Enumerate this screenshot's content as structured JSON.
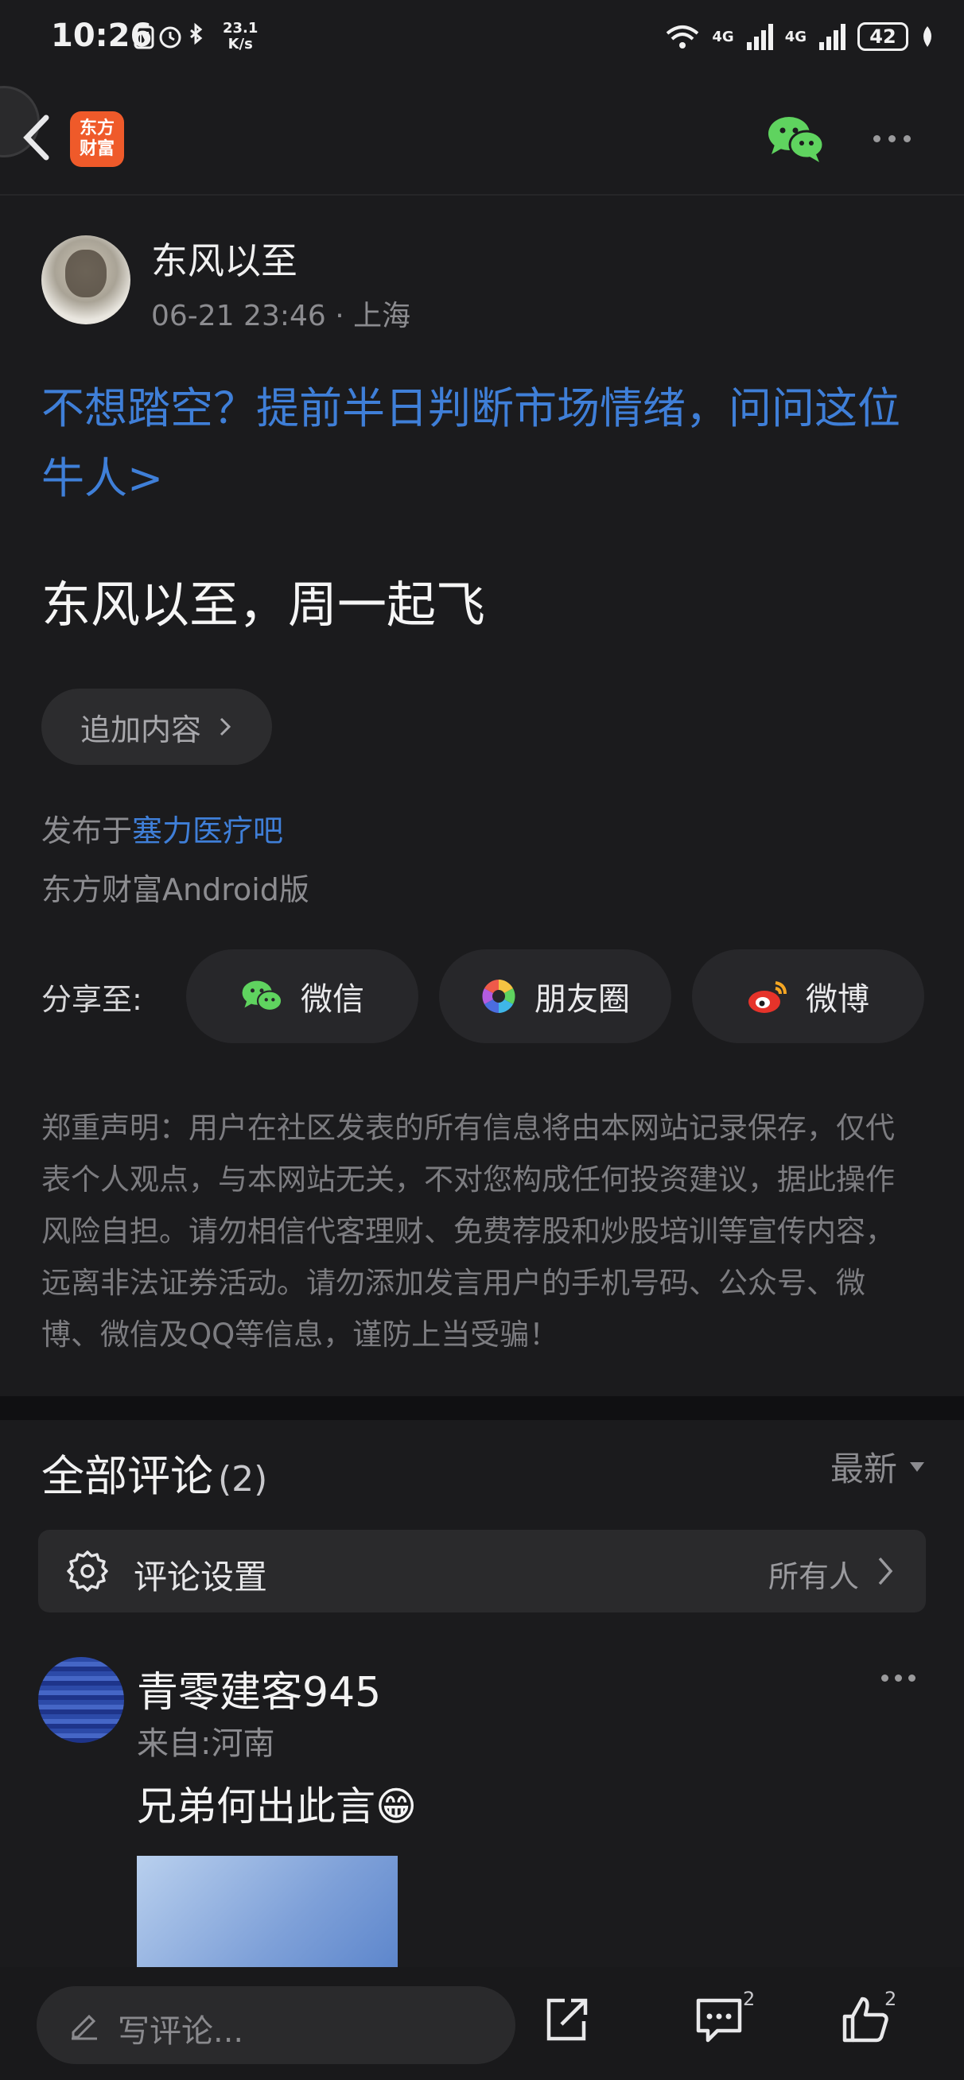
{
  "status_bar": {
    "time": "10:26",
    "speed_value": "23.1",
    "speed_unit": "K/s",
    "network_1": "4G",
    "network_2": "4G",
    "battery": "42"
  },
  "header": {
    "logo_line1": "东方",
    "logo_line2": "财富"
  },
  "post": {
    "author_name": "东风以至",
    "meta": "06-21 23:46 · 上海",
    "promo_link": "不想踏空？提前半日判断市场情绪，问问这位牛人>",
    "title": "东风以至，周一起飞",
    "add_content_label": "追加内容",
    "posted_in_prefix": "发布于",
    "forum_name": "塞力医疗吧",
    "client": "东方财富Android版"
  },
  "share": {
    "label": "分享至:",
    "wechat": "微信",
    "moments": "朋友圈",
    "weibo": "微博"
  },
  "disclaimer": "郑重声明：用户在社区发表的所有信息将由本网站记录保存，仅代表个人观点，与本网站无关，不对您构成任何投资建议，据此操作风险自担。请勿相信代客理财、免费荐股和炒股培训等宣传内容，远离非法证券活动。请勿添加发言用户的手机号码、公众号、微博、微信及QQ等信息，谨防上当受骗！",
  "comments": {
    "title": "全部评论",
    "count": "(2)",
    "sort": "最新",
    "settings_label": "评论设置",
    "settings_value": "所有人",
    "items": [
      {
        "name": "青零建客945",
        "location": "来自:河南",
        "text": "兄弟何出此言😁"
      }
    ]
  },
  "bottom_bar": {
    "placeholder": "写评论...",
    "comment_count": "2",
    "like_count": "2"
  },
  "colors": {
    "background": "#1b1b1d",
    "link_blue": "#3f7fd8",
    "logo_orange": "#ef5a2a",
    "wechat_green": "#5fd35f"
  }
}
